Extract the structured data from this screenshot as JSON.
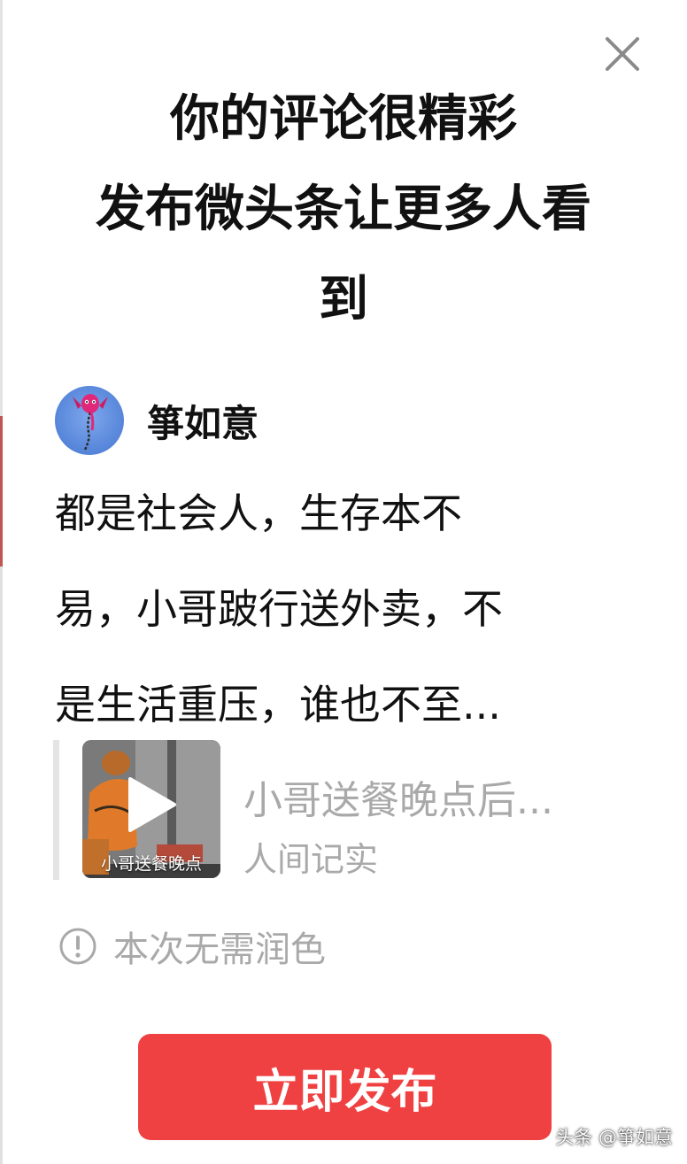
{
  "header": {
    "close_icon": "close-icon",
    "title_lines": [
      "你的评论很精彩",
      "发布微头条让更多人看",
      "到"
    ]
  },
  "author": {
    "name": "箏如意",
    "avatar_icon": "kite-avatar"
  },
  "comment": {
    "lines": [
      "都是社会人，生存本不",
      "易，小哥跛行送外卖，不",
      "是生活重压，谁也不至..."
    ]
  },
  "quoted_post": {
    "thumbnail_caption": "小哥送餐晚点",
    "title": "小哥送餐晚点后...",
    "source": "人间记实",
    "play_icon": "play-icon"
  },
  "notice": {
    "icon": "info-icon",
    "text": "本次无需润色"
  },
  "publish_button": {
    "label": "立即发布"
  },
  "watermark": "头条 @箏如意",
  "colors": {
    "accent": "#f04142",
    "muted_text": "#a9a9a9",
    "primary_text": "#111111",
    "background": "#ffffff"
  }
}
